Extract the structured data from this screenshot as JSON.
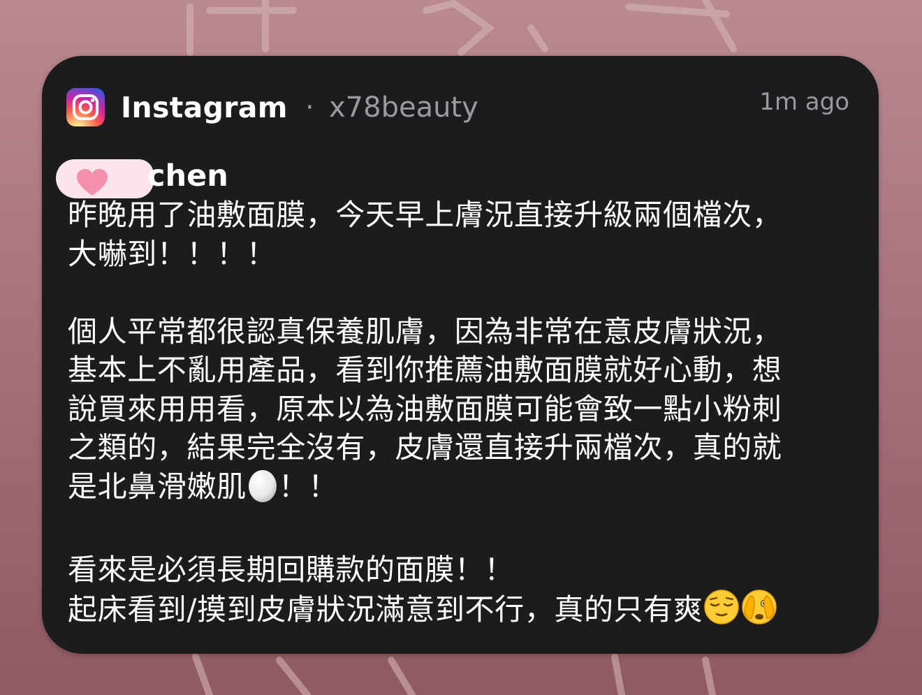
{
  "notification": {
    "app_name": "Instagram",
    "separator": "·",
    "account": "x78beauty",
    "time": "1m ago",
    "sender": "chen",
    "message_lines": [
      "昨晚用了油敷面膜，今天早上膚況直接升級兩個檔次，",
      "大嚇到！！！！",
      "",
      "個人平常都很認真保養肌膚，因為非常在意皮膚狀況，",
      "基本上不亂用產品，看到你推薦油敷面膜就好心動，想",
      "說買來用用看，原本以為油敷面膜可能會致一點小粉刺",
      "之類的，結果完全沒有，皮膚還直接升兩檔次，真的就",
      "是北鼻滑嫩肌",
      "！！",
      "",
      "看來是必須長期回購款的面膜！！",
      "起床看到/摸到皮膚狀況滿意到不行，真的只有爽"
    ]
  },
  "icons": {
    "app": "instagram-icon",
    "redaction": "heart-sticker",
    "emoji_egg": "egg-emoji",
    "emoji_relieved": "relieved-face-emoji",
    "emoji_peeking": "face-with-peeking-eye-emoji"
  },
  "colors": {
    "card": "#1c1c1e",
    "primary_text": "#ffffff",
    "secondary_text": "#9a9a9e"
  }
}
